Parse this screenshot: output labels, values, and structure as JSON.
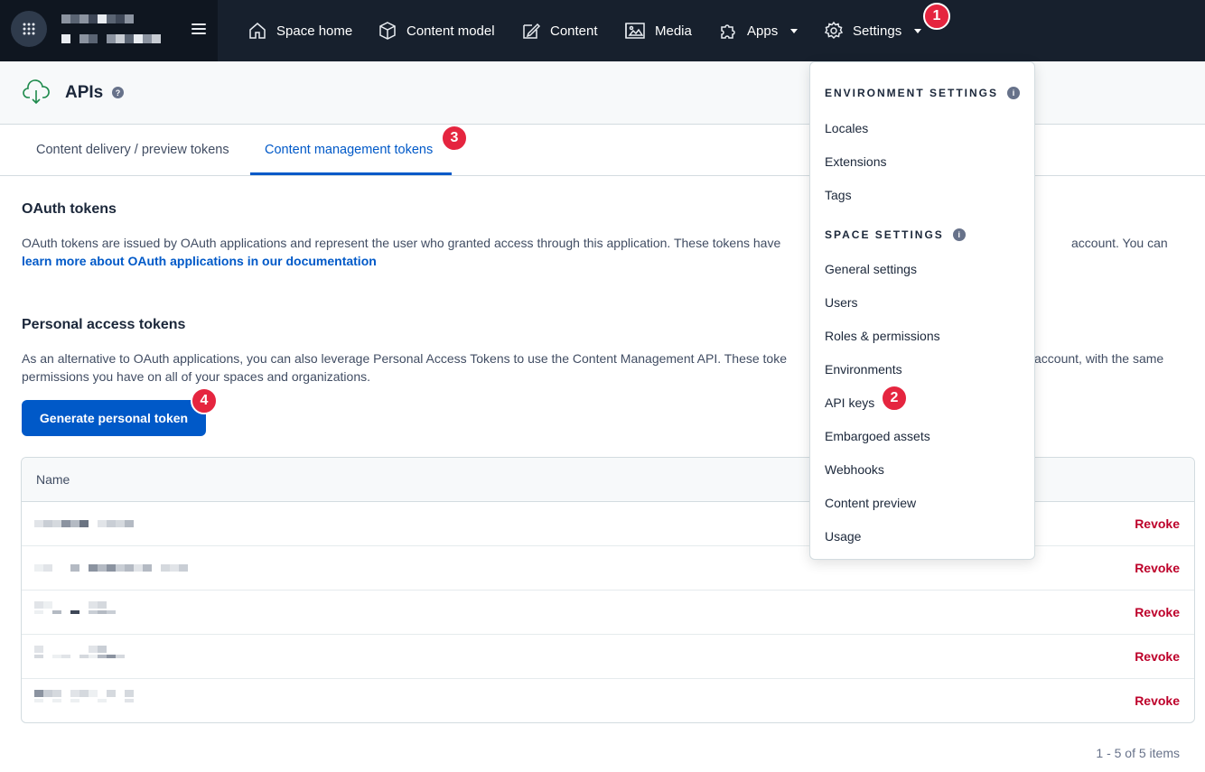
{
  "nav": {
    "items": [
      {
        "label": "Space home",
        "icon": "house-icon"
      },
      {
        "label": "Content model",
        "icon": "cube-icon"
      },
      {
        "label": "Content",
        "icon": "edit-icon"
      },
      {
        "label": "Media",
        "icon": "image-icon"
      },
      {
        "label": "Apps",
        "icon": "puzzle-icon"
      },
      {
        "label": "Settings",
        "icon": "gear-icon"
      }
    ]
  },
  "header": {
    "title": "APIs",
    "help": "?"
  },
  "tabs": [
    {
      "label": "Content delivery / preview tokens",
      "active": false
    },
    {
      "label": "Content management tokens",
      "active": true
    }
  ],
  "oauth": {
    "title": "OAuth tokens",
    "text": "OAuth tokens are issued by OAuth applications and represent the user who granted access through this application. These tokens have",
    "text_end": "account. You can",
    "link": "learn more about OAuth applications in our documentation"
  },
  "pat": {
    "title": "Personal access tokens",
    "text1": "As an alternative to OAuth applications, you can also leverage Personal Access Tokens to use the Content Management API. These toke",
    "text1_end": "account, with the same",
    "text2": "permissions you have on all of your spaces and organizations.",
    "button": "Generate personal token"
  },
  "table": {
    "header": "Name",
    "rows": [
      {
        "action": "Revoke"
      },
      {
        "action": "Revoke"
      },
      {
        "action": "Revoke"
      },
      {
        "action": "Revoke"
      },
      {
        "action": "Revoke"
      }
    ]
  },
  "pagination": "1 - 5 of 5 items",
  "dropdown": {
    "env_heading": "ENVIRONMENT SETTINGS",
    "env_items": [
      "Locales",
      "Extensions",
      "Tags"
    ],
    "space_heading": "SPACE SETTINGS",
    "space_items": [
      "General settings",
      "Users",
      "Roles & permissions",
      "Environments",
      "API keys",
      "Embargoed assets",
      "Webhooks",
      "Content preview",
      "Usage"
    ]
  },
  "badges": [
    "1",
    "2",
    "3",
    "4"
  ],
  "colors": {
    "nav_bg": "#17202d",
    "primary": "#0059c8",
    "revoke": "#bd002a",
    "badge": "#e5253f"
  }
}
